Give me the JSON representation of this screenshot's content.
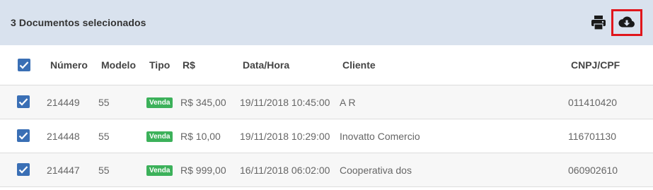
{
  "selection": {
    "count_label": "3 Documentos selecionados",
    "actions": [
      {
        "icon": "printer-icon",
        "label": ""
      },
      {
        "icon": "cloud-download-icon",
        "label": "",
        "highlight_color": "#e0161c"
      }
    ]
  },
  "colors": {
    "bar_bg": "#d9e2ee",
    "checkbox": "#3a6fb5",
    "badge_bg": "#3cb15a",
    "highlight": "#e0161c"
  },
  "table": {
    "columns": [
      "Número",
      "Modelo",
      "Tipo",
      "R$",
      "Data/Hora",
      "Cliente",
      "CNPJ/CPF"
    ],
    "select_all_checked": true,
    "rows": [
      {
        "checked": true,
        "numero": "214449",
        "modelo": "55",
        "tipo": "Venda",
        "valor": "R$ 345,00",
        "data_hora": "19/11/2018 10:45:00",
        "cliente": "A R",
        "cnpj_cpf": "011410420"
      },
      {
        "checked": true,
        "numero": "214448",
        "modelo": "55",
        "tipo": "Venda",
        "valor": "R$ 10,00",
        "data_hora": "19/11/2018 10:29:00",
        "cliente": "Inovatto Comercio",
        "cnpj_cpf": "116701130"
      },
      {
        "checked": true,
        "numero": "214447",
        "modelo": "55",
        "tipo": "Venda",
        "valor": "R$ 999,00",
        "data_hora": "16/11/2018 06:02:00",
        "cliente": "Cooperativa dos",
        "cnpj_cpf": "060902610"
      }
    ]
  }
}
